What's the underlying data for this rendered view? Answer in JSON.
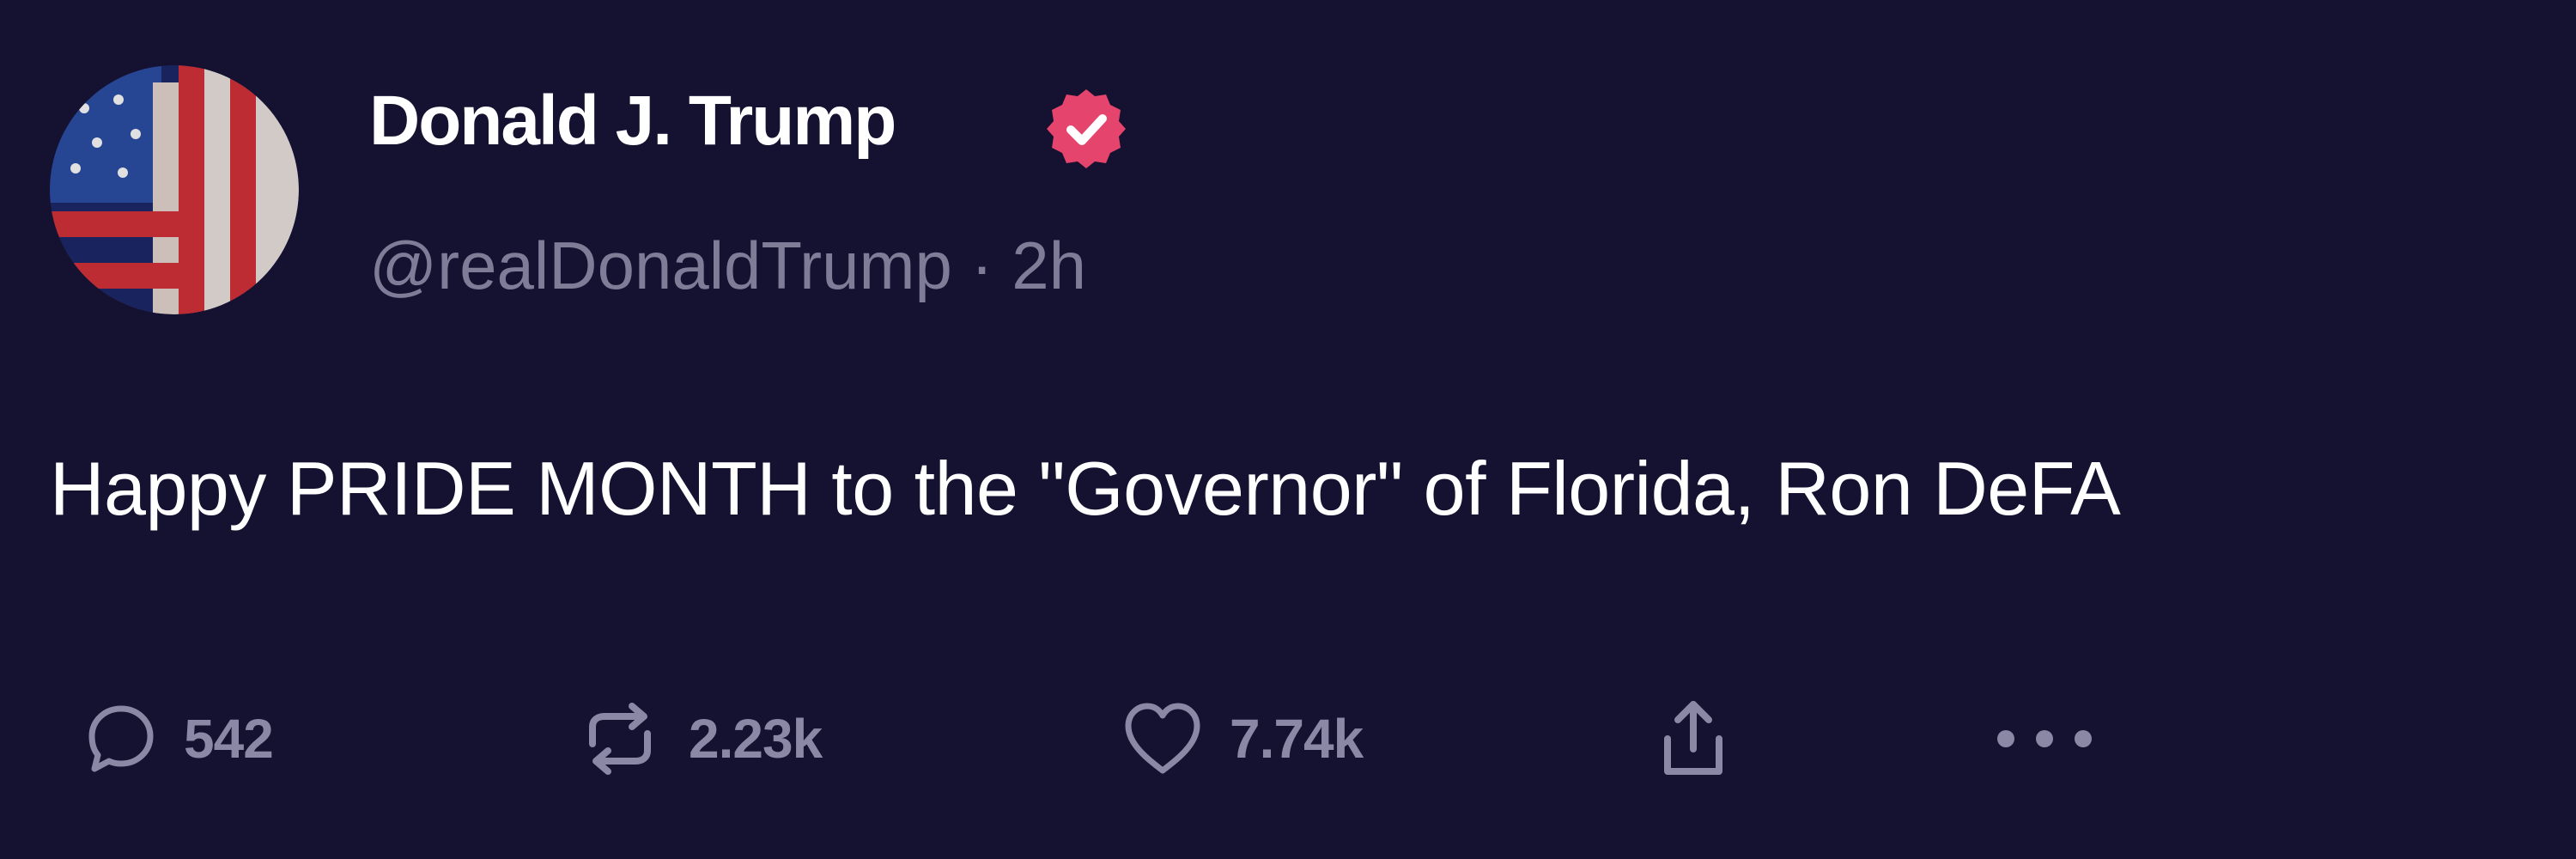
{
  "post": {
    "author": {
      "display_name": "Donald J. Trump",
      "handle": "@realDonaldTrump",
      "separator": "·",
      "time_ago": "2h",
      "verified": true,
      "badge_color": "#e5446d"
    },
    "text": "Happy PRIDE MONTH to the \"Governor\" of Florida, Ron DeFA",
    "actions": {
      "replies": "542",
      "reposts": "2.23k",
      "likes": "7.74k",
      "share_icon": "share-icon",
      "more_icon": "more-icon"
    }
  },
  "colors": {
    "background": "#141131",
    "text_primary": "#ffffff",
    "text_secondary": "#7f7c97",
    "icon": "#8b88a6"
  }
}
